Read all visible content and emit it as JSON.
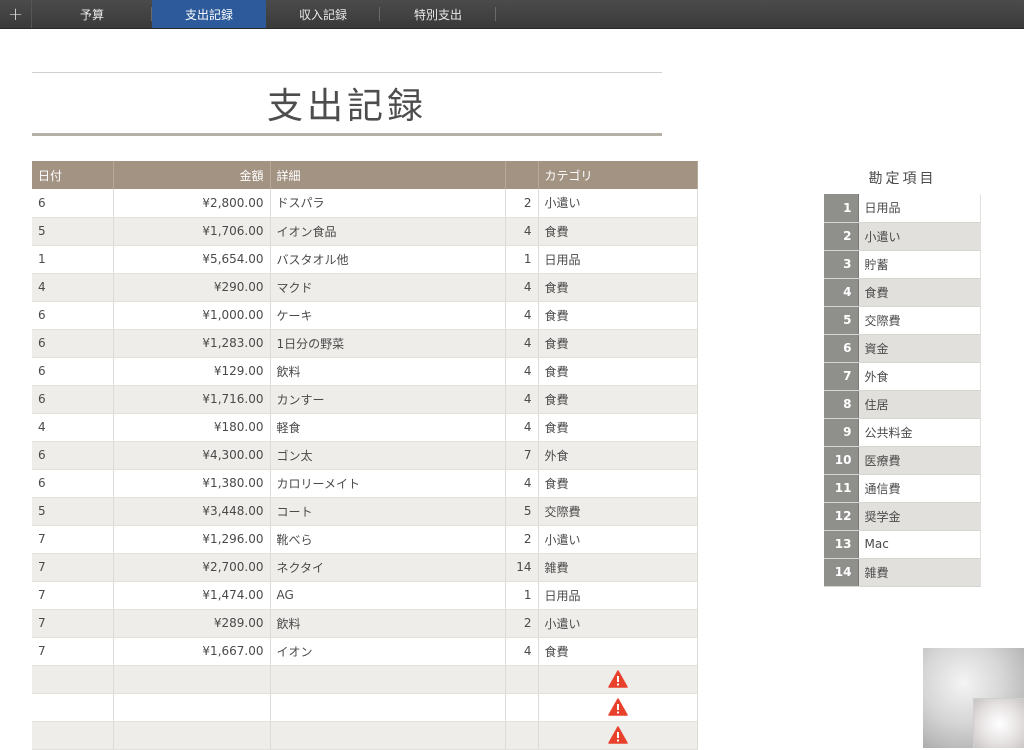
{
  "toolbar": {
    "add_label": "+",
    "tabs": [
      {
        "label": "予算"
      },
      {
        "label": "支出記録"
      },
      {
        "label": "収入記録"
      },
      {
        "label": "特別支出"
      }
    ],
    "active_tab": "支出記録"
  },
  "sheet": {
    "title": "支出記録"
  },
  "expenses": {
    "columns": [
      "日付",
      "金額",
      "詳細",
      "",
      "カテゴリ"
    ],
    "rows": [
      {
        "date": "6",
        "amount": "¥2,800.00",
        "detail": "ドスパラ",
        "code": "2",
        "category": "小遣い"
      },
      {
        "date": "5",
        "amount": "¥1,706.00",
        "detail": "イオン食品",
        "code": "4",
        "category": "食費"
      },
      {
        "date": "1",
        "amount": "¥5,654.00",
        "detail": "バスタオル他",
        "code": "1",
        "category": "日用品"
      },
      {
        "date": "4",
        "amount": "¥290.00",
        "detail": "マクド",
        "code": "4",
        "category": "食費"
      },
      {
        "date": "6",
        "amount": "¥1,000.00",
        "detail": "ケーキ",
        "code": "4",
        "category": "食費"
      },
      {
        "date": "6",
        "amount": "¥1,283.00",
        "detail": "1日分の野菜",
        "code": "4",
        "category": "食費"
      },
      {
        "date": "6",
        "amount": "¥129.00",
        "detail": "飲料",
        "code": "4",
        "category": "食費"
      },
      {
        "date": "6",
        "amount": "¥1,716.00",
        "detail": "カンすー",
        "code": "4",
        "category": "食費"
      },
      {
        "date": "4",
        "amount": "¥180.00",
        "detail": "軽食",
        "code": "4",
        "category": "食費"
      },
      {
        "date": "6",
        "amount": "¥4,300.00",
        "detail": "ゴン太",
        "code": "7",
        "category": "外食"
      },
      {
        "date": "6",
        "amount": "¥1,380.00",
        "detail": "カロリーメイト",
        "code": "4",
        "category": "食費"
      },
      {
        "date": "5",
        "amount": "¥3,448.00",
        "detail": "コート",
        "code": "5",
        "category": "交際費"
      },
      {
        "date": "7",
        "amount": "¥1,296.00",
        "detail": "靴べら",
        "code": "2",
        "category": "小遣い"
      },
      {
        "date": "7",
        "amount": "¥2,700.00",
        "detail": "ネクタイ",
        "code": "14",
        "category": "雑費"
      },
      {
        "date": "7",
        "amount": "¥1,474.00",
        "detail": "AG",
        "code": "1",
        "category": "日用品"
      },
      {
        "date": "7",
        "amount": "¥289.00",
        "detail": "飲料",
        "code": "2",
        "category": "小遣い"
      },
      {
        "date": "7",
        "amount": "¥1,667.00",
        "detail": "イオン",
        "code": "4",
        "category": "食費"
      }
    ],
    "empty_rows_with_warning": 3,
    "warning_icon": "warning-triangle-icon",
    "warning_color": "#e8412c"
  },
  "accounts": {
    "title": "勘定項目",
    "items": [
      {
        "no": "1",
        "name": "日用品"
      },
      {
        "no": "2",
        "name": "小遣い"
      },
      {
        "no": "3",
        "name": "貯蓄"
      },
      {
        "no": "4",
        "name": "食費"
      },
      {
        "no": "5",
        "name": "交際費"
      },
      {
        "no": "6",
        "name": "資金"
      },
      {
        "no": "7",
        "name": "外食"
      },
      {
        "no": "8",
        "name": "住居"
      },
      {
        "no": "9",
        "name": "公共料金"
      },
      {
        "no": "10",
        "name": "医療費"
      },
      {
        "no": "11",
        "name": "通信費"
      },
      {
        "no": "12",
        "name": "奨学金"
      },
      {
        "no": "13",
        "name": "Mac"
      },
      {
        "no": "14",
        "name": "雑費"
      }
    ]
  },
  "colors": {
    "header_bg": "#a39383",
    "active_tab": "#2d5a9a",
    "account_no_bg": "#8f8f8c"
  }
}
